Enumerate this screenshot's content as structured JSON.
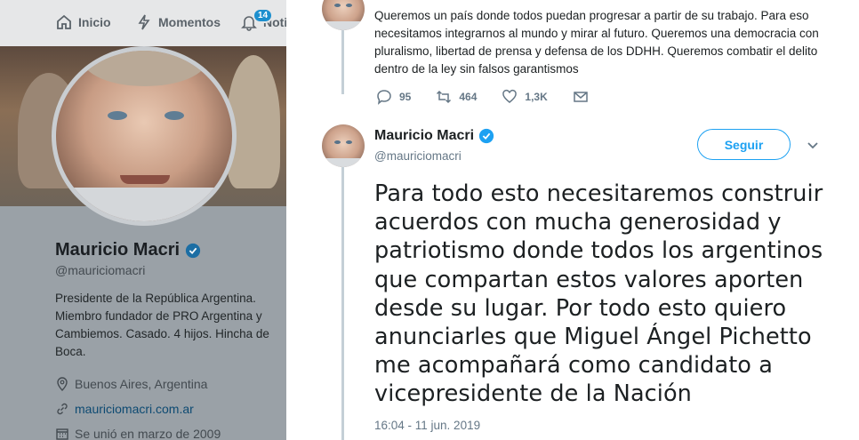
{
  "nav": {
    "home_label": "Inicio",
    "moments_label": "Momentos",
    "notifications_label": "Notif",
    "notifications_count": "14"
  },
  "profile": {
    "name": "Mauricio Macri",
    "handle": "@mauriciomacri",
    "bio": "Presidente de la República Argentina. Miembro fundador de PRO Argentina y Cambiemos. Casado. 4 hijos. Hincha de Boca.",
    "location": "Buenos Aires, Argentina",
    "website": "mauriciomacri.com.ar",
    "joined": "Se unió en marzo de 2009"
  },
  "previous_tweet": {
    "text": "Queremos un país donde todos puedan progresar a partir de su trabajo. Para eso necesitamos integrarnos al mundo y mirar al futuro. Queremos una democracia con pluralismo, libertad de prensa y defensa de los DDHH. Queremos combatir el delito dentro de la ley sin falsos garantismos",
    "replies": "95",
    "retweets": "464",
    "likes": "1,3K"
  },
  "main_tweet": {
    "author_name": "Mauricio Macri",
    "author_handle": "@mauriciomacri",
    "follow_label": "Seguir",
    "text": "Para todo esto necesitaremos construir acuerdos con mucha generosidad y patriotismo donde todos los argentinos que compartan estos valores aporten desde su lugar. Por todo esto quiero anunciarles que Miguel Ángel Pichetto me acompañará como candidato a vicepresidente de la Nación",
    "timestamp": "16:04 - 11 jun. 2019"
  },
  "colors": {
    "accent": "#1da1f2",
    "text_primary": "#1c2022",
    "text_secondary": "#657786"
  }
}
